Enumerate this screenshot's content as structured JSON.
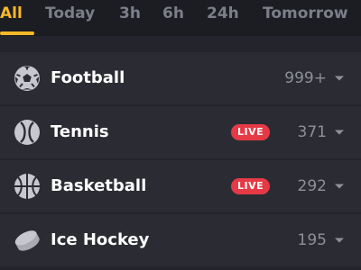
{
  "tabs": [
    {
      "label": "All",
      "active": true
    },
    {
      "label": "Today",
      "active": false
    },
    {
      "label": "3h",
      "active": false
    },
    {
      "label": "6h",
      "active": false
    },
    {
      "label": "24h",
      "active": false
    },
    {
      "label": "Tomorrow",
      "active": false
    }
  ],
  "colors": {
    "accent": "#f7b829",
    "live_badge": "#e63946",
    "background": "#24252c",
    "row_background": "#2b2c33"
  },
  "sports": [
    {
      "name": "Football",
      "icon": "football-icon",
      "live": false,
      "count": "999+"
    },
    {
      "name": "Tennis",
      "icon": "tennis-icon",
      "live": true,
      "live_label": "LIVE",
      "count": "371"
    },
    {
      "name": "Basketball",
      "icon": "basketball-icon",
      "live": true,
      "live_label": "LIVE",
      "count": "292"
    },
    {
      "name": "Ice Hockey",
      "icon": "hockey-puck-icon",
      "live": false,
      "count": "195"
    }
  ]
}
